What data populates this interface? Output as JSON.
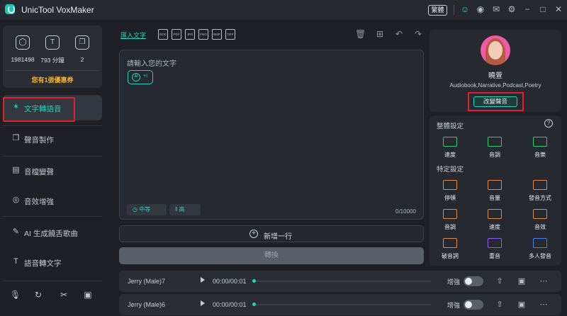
{
  "app": {
    "title": "UnicTool VoxMaker",
    "lang_button": "繁體"
  },
  "titlebar_icons": [
    "user-icon",
    "discord-icon",
    "mail-icon",
    "settings-icon",
    "minimize-icon",
    "maximize-icon",
    "close-icon"
  ],
  "stats": {
    "items": [
      {
        "icon": "character-count-icon",
        "value": "1981498"
      },
      {
        "icon": "minutes-icon",
        "value": "793 分鐘"
      },
      {
        "icon": "copies-icon",
        "value": "2"
      }
    ],
    "coupon": "您有1張優惠券"
  },
  "sidebar": {
    "items": [
      {
        "label": "文字轉語音",
        "icon": "tts-icon",
        "active": true
      },
      {
        "label": "聲音製作",
        "icon": "voice-make-icon"
      },
      {
        "label": "音檔變聲",
        "icon": "voice-change-icon"
      },
      {
        "label": "音效增強",
        "icon": "sound-enhance-icon"
      },
      {
        "label": "AI 生成饒舌歌曲",
        "icon": "ai-rap-icon"
      },
      {
        "label": "語音轉文字",
        "icon": "speech-to-text-icon"
      }
    ],
    "bottom_icons": [
      "microphone-icon",
      "loop-icon",
      "scissors-icon",
      "toolbox-icon"
    ]
  },
  "toolbar": {
    "import_label": "匯入文字",
    "file_types": [
      "DOC",
      "PDF",
      "JPG",
      "PNG",
      "BMP",
      "TIFF"
    ],
    "edit_icons": [
      "trash-icon",
      "add-box-icon",
      "undo-icon",
      "redo-icon"
    ]
  },
  "editor": {
    "placeholder": "請輸入您的文字",
    "ai_chip": {
      "badge": "AI",
      "text": "+I"
    },
    "speed_label": "中等",
    "pitch_label": "高",
    "char_count": "0/10000"
  },
  "actions": {
    "add_line": "新增一行",
    "convert": "轉換"
  },
  "voice": {
    "name": "曉萱",
    "tags": "Audiobook,Narrative,Podcast,Poetry",
    "change_button": "改變聲音"
  },
  "settings": {
    "overall_title": "整體設定",
    "overall": [
      {
        "label": "速度",
        "icon": "speed-gauge-icon"
      },
      {
        "label": "音調",
        "icon": "pitch-bars-icon"
      },
      {
        "label": "音樂",
        "icon": "music-note-icon"
      }
    ],
    "specific_title": "特定設定",
    "specific": [
      {
        "label": "停頓",
        "icon": "pause-icon"
      },
      {
        "label": "音量",
        "icon": "volume-icon"
      },
      {
        "label": "發音方式",
        "icon": "pronunciation-icon"
      },
      {
        "label": "音調",
        "icon": "pitch-icon"
      },
      {
        "label": "速度",
        "icon": "speed-icon"
      },
      {
        "label": "音效",
        "icon": "sound-effect-icon"
      },
      {
        "label": "破音詞",
        "icon": "polyphone-icon"
      },
      {
        "label": "重音",
        "icon": "stress-icon"
      },
      {
        "label": "多人發音",
        "icon": "multi-speaker-icon"
      }
    ]
  },
  "voice_rows": [
    {
      "name": "Jerry (Male)7",
      "time": "00:00/00:01",
      "boost_label": "增強"
    },
    {
      "name": "Jerry (Male)6",
      "time": "00:00/00:01",
      "boost_label": "增強"
    }
  ]
}
